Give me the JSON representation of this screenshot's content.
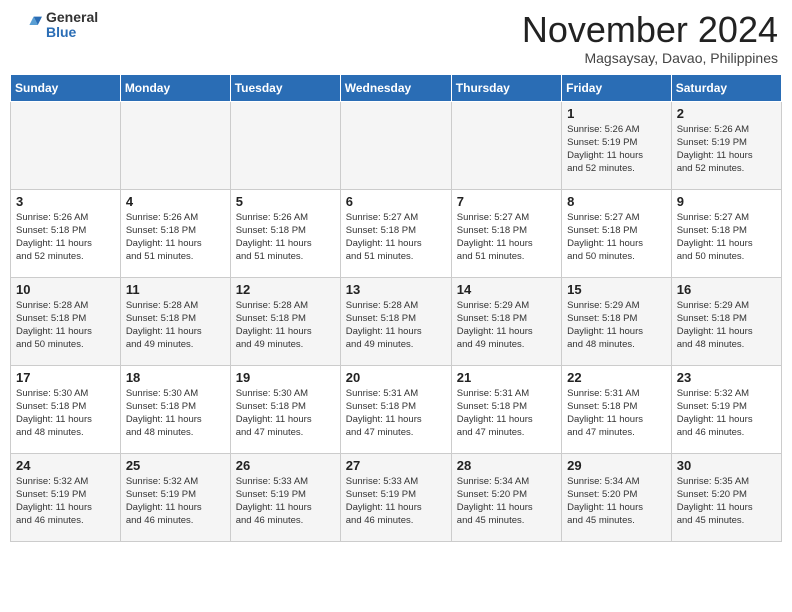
{
  "header": {
    "logo_general": "General",
    "logo_blue": "Blue",
    "month_title": "November 2024",
    "location": "Magsaysay, Davao, Philippines"
  },
  "days_of_week": [
    "Sunday",
    "Monday",
    "Tuesday",
    "Wednesday",
    "Thursday",
    "Friday",
    "Saturday"
  ],
  "weeks": [
    [
      {
        "day": "",
        "info": ""
      },
      {
        "day": "",
        "info": ""
      },
      {
        "day": "",
        "info": ""
      },
      {
        "day": "",
        "info": ""
      },
      {
        "day": "",
        "info": ""
      },
      {
        "day": "1",
        "info": "Sunrise: 5:26 AM\nSunset: 5:19 PM\nDaylight: 11 hours\nand 52 minutes."
      },
      {
        "day": "2",
        "info": "Sunrise: 5:26 AM\nSunset: 5:19 PM\nDaylight: 11 hours\nand 52 minutes."
      }
    ],
    [
      {
        "day": "3",
        "info": "Sunrise: 5:26 AM\nSunset: 5:18 PM\nDaylight: 11 hours\nand 52 minutes."
      },
      {
        "day": "4",
        "info": "Sunrise: 5:26 AM\nSunset: 5:18 PM\nDaylight: 11 hours\nand 51 minutes."
      },
      {
        "day": "5",
        "info": "Sunrise: 5:26 AM\nSunset: 5:18 PM\nDaylight: 11 hours\nand 51 minutes."
      },
      {
        "day": "6",
        "info": "Sunrise: 5:27 AM\nSunset: 5:18 PM\nDaylight: 11 hours\nand 51 minutes."
      },
      {
        "day": "7",
        "info": "Sunrise: 5:27 AM\nSunset: 5:18 PM\nDaylight: 11 hours\nand 51 minutes."
      },
      {
        "day": "8",
        "info": "Sunrise: 5:27 AM\nSunset: 5:18 PM\nDaylight: 11 hours\nand 50 minutes."
      },
      {
        "day": "9",
        "info": "Sunrise: 5:27 AM\nSunset: 5:18 PM\nDaylight: 11 hours\nand 50 minutes."
      }
    ],
    [
      {
        "day": "10",
        "info": "Sunrise: 5:28 AM\nSunset: 5:18 PM\nDaylight: 11 hours\nand 50 minutes."
      },
      {
        "day": "11",
        "info": "Sunrise: 5:28 AM\nSunset: 5:18 PM\nDaylight: 11 hours\nand 49 minutes."
      },
      {
        "day": "12",
        "info": "Sunrise: 5:28 AM\nSunset: 5:18 PM\nDaylight: 11 hours\nand 49 minutes."
      },
      {
        "day": "13",
        "info": "Sunrise: 5:28 AM\nSunset: 5:18 PM\nDaylight: 11 hours\nand 49 minutes."
      },
      {
        "day": "14",
        "info": "Sunrise: 5:29 AM\nSunset: 5:18 PM\nDaylight: 11 hours\nand 49 minutes."
      },
      {
        "day": "15",
        "info": "Sunrise: 5:29 AM\nSunset: 5:18 PM\nDaylight: 11 hours\nand 48 minutes."
      },
      {
        "day": "16",
        "info": "Sunrise: 5:29 AM\nSunset: 5:18 PM\nDaylight: 11 hours\nand 48 minutes."
      }
    ],
    [
      {
        "day": "17",
        "info": "Sunrise: 5:30 AM\nSunset: 5:18 PM\nDaylight: 11 hours\nand 48 minutes."
      },
      {
        "day": "18",
        "info": "Sunrise: 5:30 AM\nSunset: 5:18 PM\nDaylight: 11 hours\nand 48 minutes."
      },
      {
        "day": "19",
        "info": "Sunrise: 5:30 AM\nSunset: 5:18 PM\nDaylight: 11 hours\nand 47 minutes."
      },
      {
        "day": "20",
        "info": "Sunrise: 5:31 AM\nSunset: 5:18 PM\nDaylight: 11 hours\nand 47 minutes."
      },
      {
        "day": "21",
        "info": "Sunrise: 5:31 AM\nSunset: 5:18 PM\nDaylight: 11 hours\nand 47 minutes."
      },
      {
        "day": "22",
        "info": "Sunrise: 5:31 AM\nSunset: 5:18 PM\nDaylight: 11 hours\nand 47 minutes."
      },
      {
        "day": "23",
        "info": "Sunrise: 5:32 AM\nSunset: 5:19 PM\nDaylight: 11 hours\nand 46 minutes."
      }
    ],
    [
      {
        "day": "24",
        "info": "Sunrise: 5:32 AM\nSunset: 5:19 PM\nDaylight: 11 hours\nand 46 minutes."
      },
      {
        "day": "25",
        "info": "Sunrise: 5:32 AM\nSunset: 5:19 PM\nDaylight: 11 hours\nand 46 minutes."
      },
      {
        "day": "26",
        "info": "Sunrise: 5:33 AM\nSunset: 5:19 PM\nDaylight: 11 hours\nand 46 minutes."
      },
      {
        "day": "27",
        "info": "Sunrise: 5:33 AM\nSunset: 5:19 PM\nDaylight: 11 hours\nand 46 minutes."
      },
      {
        "day": "28",
        "info": "Sunrise: 5:34 AM\nSunset: 5:20 PM\nDaylight: 11 hours\nand 45 minutes."
      },
      {
        "day": "29",
        "info": "Sunrise: 5:34 AM\nSunset: 5:20 PM\nDaylight: 11 hours\nand 45 minutes."
      },
      {
        "day": "30",
        "info": "Sunrise: 5:35 AM\nSunset: 5:20 PM\nDaylight: 11 hours\nand 45 minutes."
      }
    ]
  ]
}
